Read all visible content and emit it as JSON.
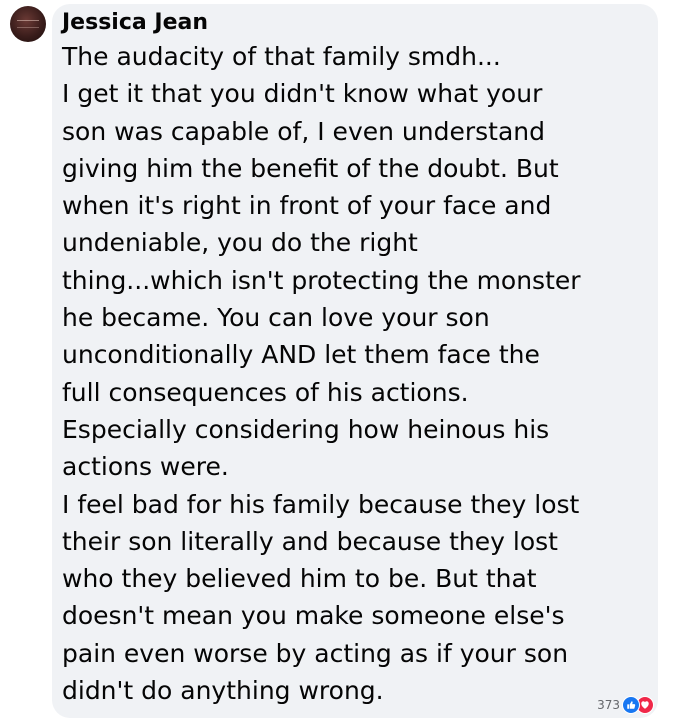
{
  "comment": {
    "author": "Jessica Jean",
    "lines": [
      "The audacity of that family smdh...",
      "I get it that you didn't know what your",
      "son was capable of, I even understand",
      "giving him the benefit of the doubt. But",
      "when it's right in front of your face and",
      "undeniable, you do the right",
      "thing...which isn't protecting the monster",
      "he became. You can love your son",
      "unconditionally AND let them face the",
      "full consequences of his actions.",
      "Especially considering how heinous his",
      "actions were.",
      "I feel bad for his family because they lost",
      "their son literally and because they lost",
      "who they believed him to be. But that",
      "doesn't mean you make someone else's",
      "pain even worse by acting as if your son",
      "didn't do anything wrong."
    ],
    "reactions": {
      "count": "373",
      "icons": [
        "like-icon",
        "love-icon"
      ],
      "colors": {
        "like": "#1877f2",
        "love": "#f02849"
      }
    }
  }
}
